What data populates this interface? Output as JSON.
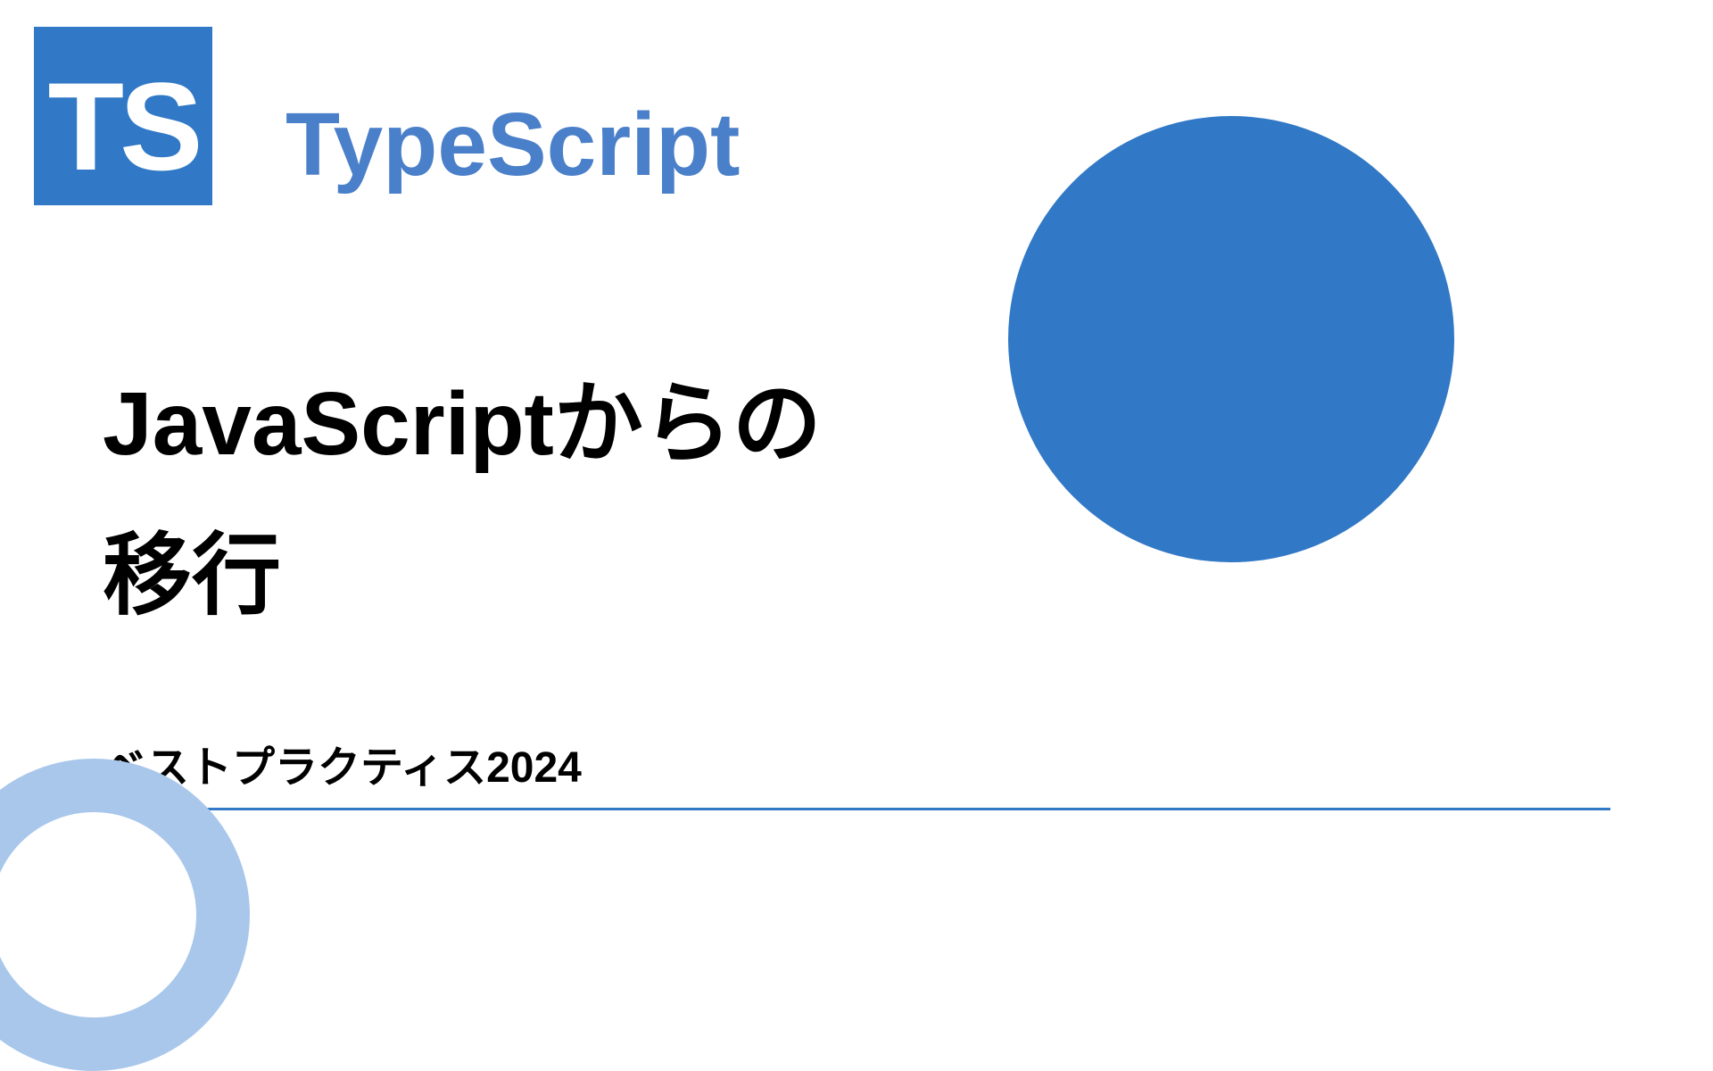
{
  "logo": {
    "text": "TS"
  },
  "brand": {
    "title": "TypeScript"
  },
  "main": {
    "title_line1": "JavaScriptからの",
    "title_line2": "移行"
  },
  "subtitle": {
    "text": "ベストプラクティス2024"
  },
  "colors": {
    "primary": "#3178c6",
    "accent_light": "#a9c7eb",
    "brand_text": "#4a7fc9"
  }
}
